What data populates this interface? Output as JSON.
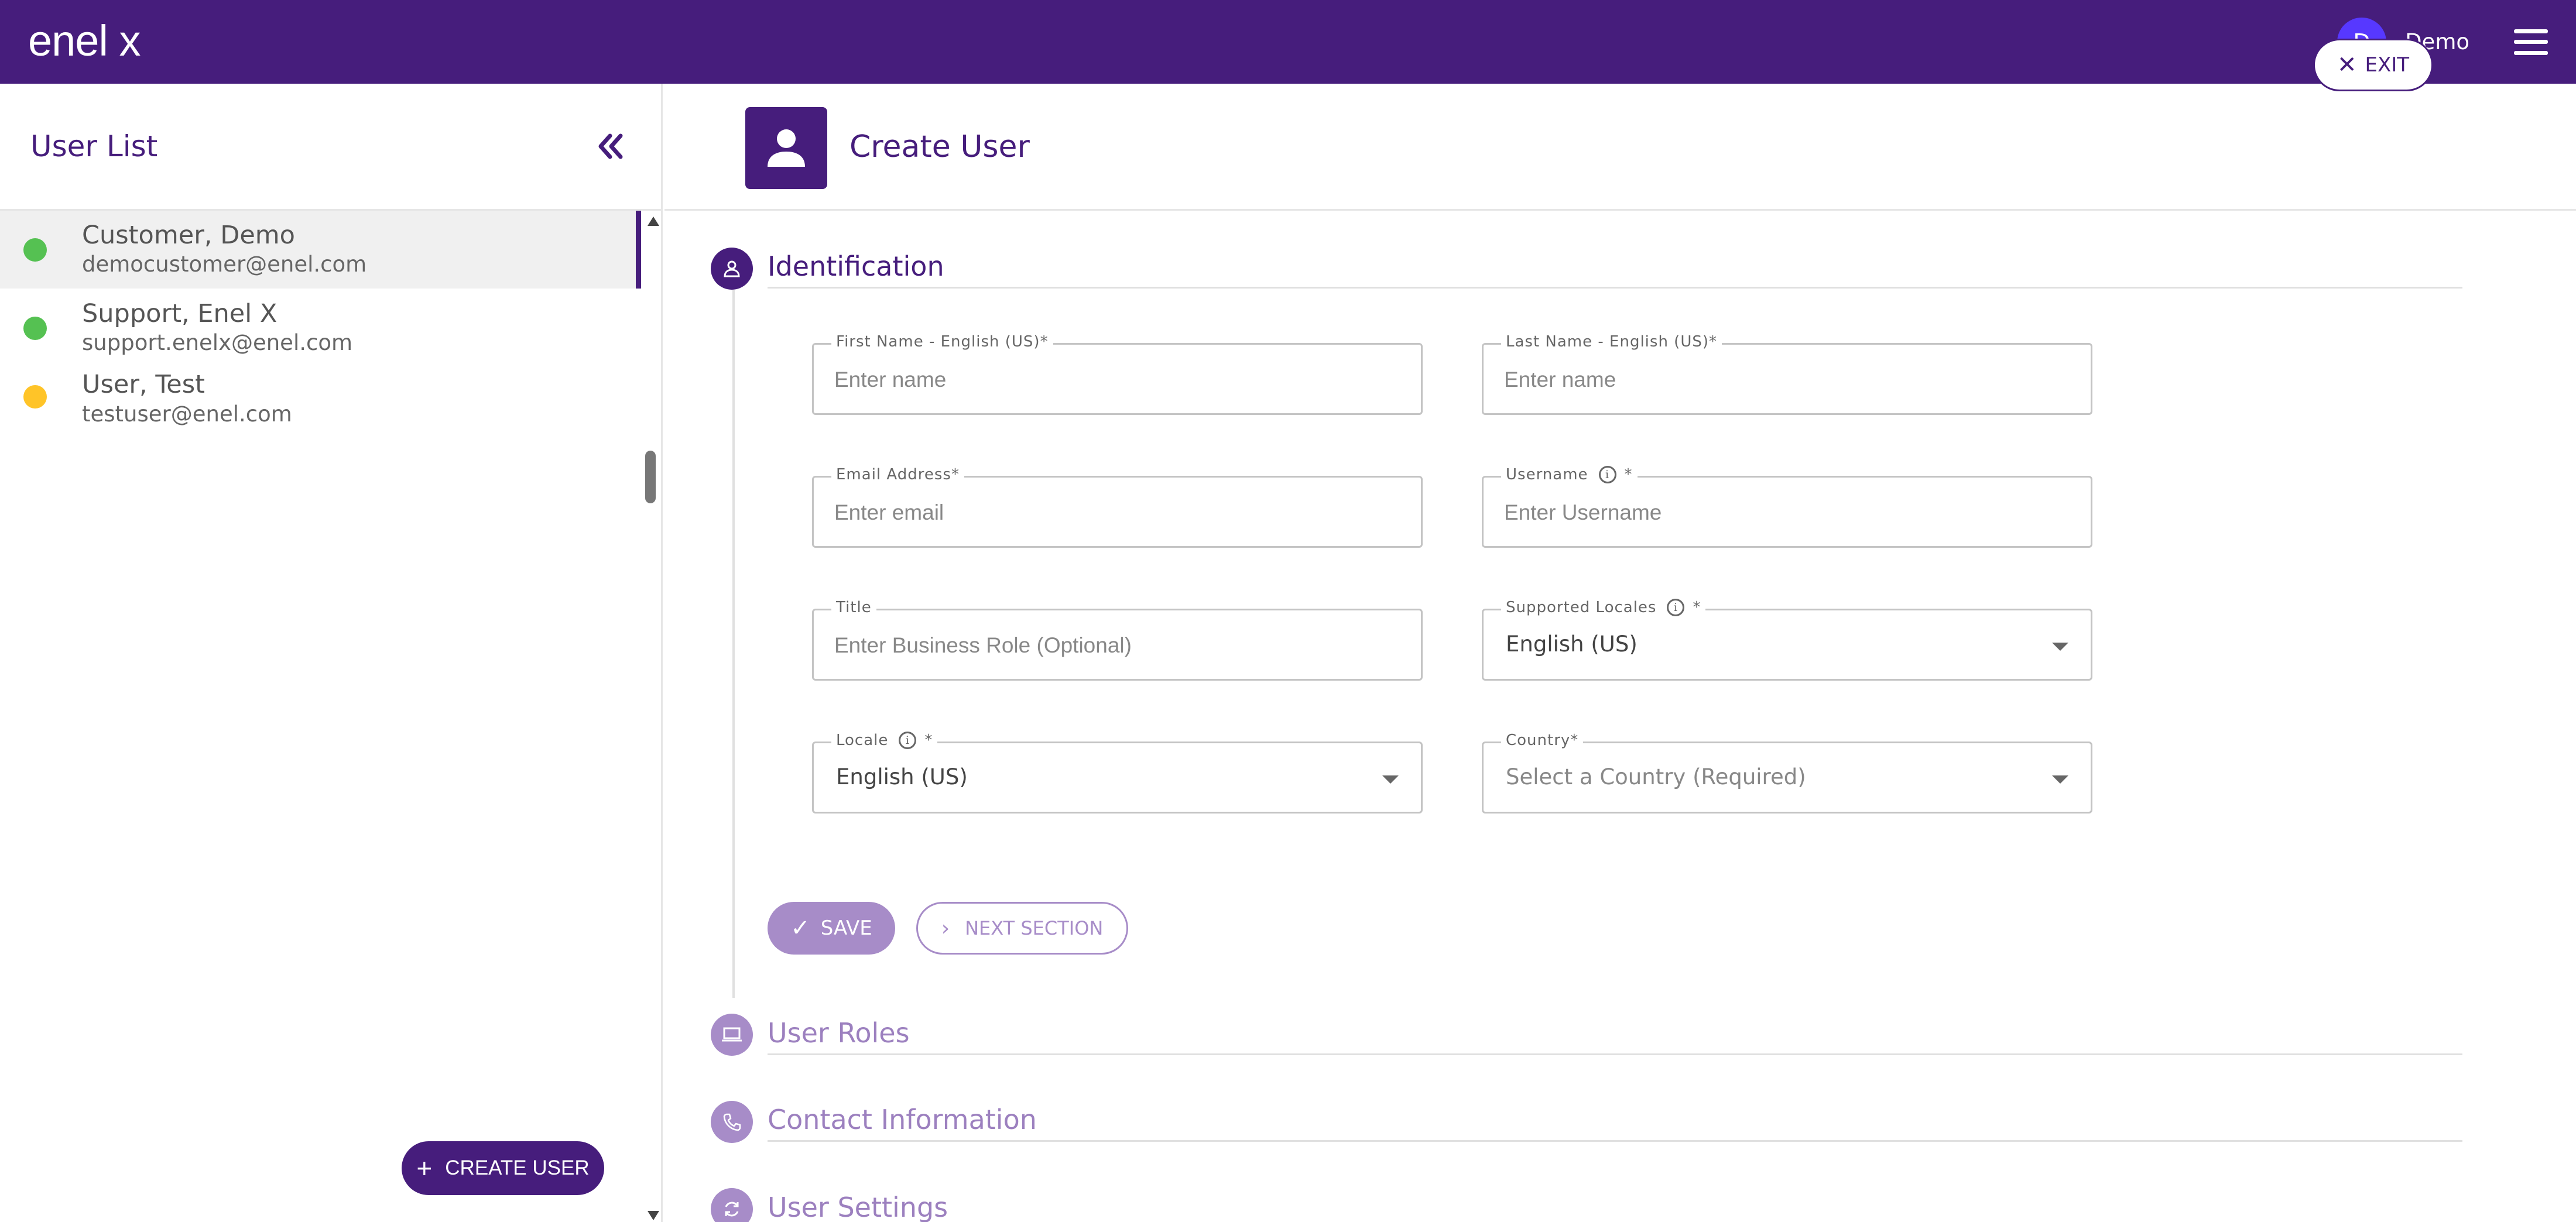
{
  "app": {
    "logo_text": "enel x",
    "user_initial": "D",
    "user_name": "Demo"
  },
  "sidebar": {
    "title": "User List",
    "users": [
      {
        "name": "Customer, Demo",
        "email": "democustomer@enel.com",
        "status": "active",
        "status_color": "#55c152"
      },
      {
        "name": "Support, Enel X",
        "email": "support.enelx@enel.com",
        "status": "active",
        "status_color": "#55c152"
      },
      {
        "name": "User, Test",
        "email": "testuser@enel.com",
        "status": "pending",
        "status_color": "#ffc428"
      }
    ],
    "create_user_label": "CREATE USER"
  },
  "main": {
    "title": "Create User",
    "exit_label": "EXIT",
    "sections": [
      {
        "title": "Identification",
        "state": "active",
        "icon": "person-icon"
      },
      {
        "title": "User Roles",
        "state": "inactive",
        "icon": "laptop-icon"
      },
      {
        "title": "Contact Information",
        "state": "inactive",
        "icon": "phone-icon"
      },
      {
        "title": "User Settings",
        "state": "inactive",
        "icon": "sync-icon"
      }
    ],
    "form": {
      "first_name": {
        "label": "First Name - English (US)",
        "required": "*",
        "placeholder": "Enter name"
      },
      "last_name": {
        "label": "Last Name - English (US)",
        "required": "*",
        "placeholder": "Enter name"
      },
      "email": {
        "label": "Email Address",
        "required": "*",
        "placeholder": "Enter email"
      },
      "username": {
        "label": "Username",
        "required": "*",
        "placeholder": "Enter Username"
      },
      "title": {
        "label": "Title",
        "placeholder": "Enter Business Role (Optional)"
      },
      "supported_locales": {
        "label": "Supported Locales",
        "required": "*",
        "value": "English (US)"
      },
      "locale": {
        "label": "Locale",
        "required": "*",
        "value": "English (US)"
      },
      "country": {
        "label": "Country",
        "required": "*",
        "placeholder": "Select a Country (Required)"
      }
    },
    "save_label": "SAVE",
    "next_label": "NEXT SECTION"
  },
  "colors": {
    "brand": "#461d7c",
    "brand_light": "#a78cc8",
    "avatar": "#5738ff",
    "active_status": "#55c152",
    "pending_status": "#ffc428"
  }
}
